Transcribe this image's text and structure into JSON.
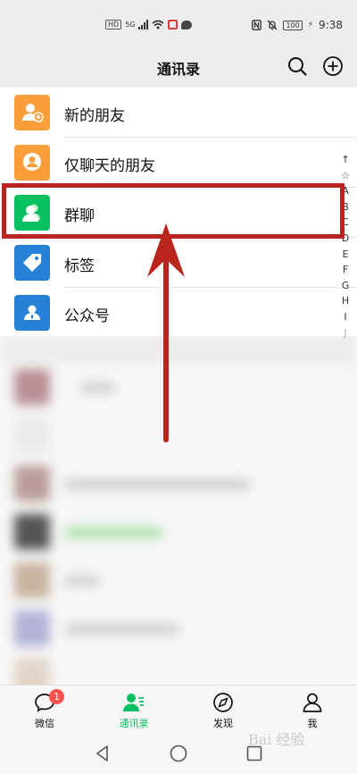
{
  "status_bar": {
    "hd": "HD",
    "network": "5G",
    "battery": "100",
    "time": "9:38"
  },
  "nav": {
    "title": "通讯录",
    "search_icon": "search-icon",
    "add_icon": "plus-circle-icon"
  },
  "entries": [
    {
      "label": "新的朋友",
      "icon": "add-friend-icon",
      "color": "#fa9d3b"
    },
    {
      "label": "仅聊天的朋友",
      "icon": "chat-only-friend-icon",
      "color": "#fa9d3b"
    },
    {
      "label": "群聊",
      "icon": "group-chat-icon",
      "color": "#07c160"
    },
    {
      "label": "标签",
      "icon": "tag-icon",
      "color": "#2782d7"
    },
    {
      "label": "公众号",
      "icon": "official-account-icon",
      "color": "#2782d7"
    }
  ],
  "index_bar": [
    "↑",
    "☆",
    "A",
    "B",
    "C",
    "D",
    "E",
    "F",
    "G",
    "H",
    "I",
    "J"
  ],
  "tabs": [
    {
      "label": "微信",
      "icon": "chat-bubble-icon",
      "badge": "1"
    },
    {
      "label": "通讯录",
      "icon": "contacts-icon",
      "active": true
    },
    {
      "label": "发现",
      "icon": "compass-icon"
    },
    {
      "label": "我",
      "icon": "person-icon"
    }
  ],
  "system_nav": [
    "back-icon",
    "home-icon",
    "recents-icon"
  ],
  "watermark": "Bai 经验",
  "colors": {
    "accent_green": "#07c160",
    "annotation_red": "#b9241c",
    "badge_red": "#fa5151"
  }
}
